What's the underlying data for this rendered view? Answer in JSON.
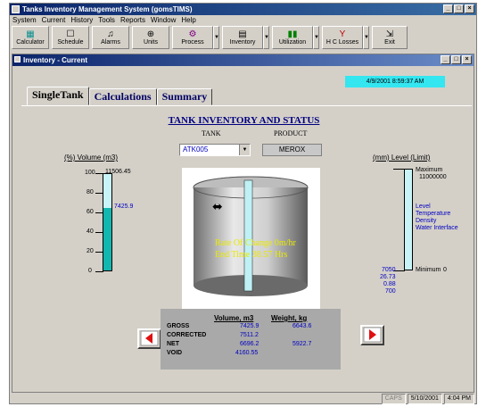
{
  "app": {
    "title": "Tanks Inventory Management System (gomsTIMS)",
    "menu": [
      "System",
      "Current",
      "History",
      "Tools",
      "Reports",
      "Window",
      "Help"
    ],
    "toolbar": [
      {
        "label": "Calculator",
        "icon": "calculator-icon"
      },
      {
        "label": "Schedule",
        "icon": "schedule-icon"
      },
      {
        "label": "Alarms",
        "icon": "bell-icon"
      },
      {
        "label": "Units",
        "icon": "units-icon"
      },
      {
        "label": "Process",
        "icon": "process-icon",
        "dropdown": true
      },
      {
        "label": "Inventory",
        "icon": "inventory-icon",
        "dropdown": true
      },
      {
        "label": "Utilization",
        "icon": "utilization-chart-icon",
        "dropdown": true
      },
      {
        "label": "H C Losses",
        "icon": "losses-icon",
        "dropdown": true
      },
      {
        "label": "Exit",
        "icon": "exit-icon"
      }
    ]
  },
  "child": {
    "title": "Inventory - Current",
    "datetime": "4/9/2001 8:59:37 AM",
    "tabs": [
      "SingleTank",
      "Calculations",
      "Summary"
    ],
    "active_tab": "SingleTank"
  },
  "main": {
    "heading": "TANK INVENTORY AND STATUS",
    "tank_label": "TANK",
    "product_label": "PRODUCT",
    "tank_value": "ATK005",
    "product_value": "MEROX"
  },
  "volume_gauge": {
    "title": "(%) Volume (m3)",
    "max_value": "11506.45",
    "current_value": "7425.9",
    "fill_percent": 64.5,
    "ticks": [
      "100",
      "80",
      "60",
      "40",
      "20",
      "0"
    ]
  },
  "level_gauge": {
    "title": "(mm) Level (Limit)",
    "maximum_label": "Maximum",
    "maximum_value": "11000000",
    "minimum_label": "Minimum",
    "minimum_value": "0",
    "legend": [
      "Level",
      "Temperature",
      "Density",
      "Water Interface"
    ],
    "readings": [
      "7050",
      "26.73",
      "0.88",
      "700"
    ]
  },
  "tank_overlay": {
    "rate_of_change": "Rate Of Change  0m/hr",
    "end_time": "End Time  38:57 Hrs"
  },
  "table": {
    "headers": [
      "Volume, m3",
      "Weight, kg"
    ],
    "rows": [
      {
        "label": "GROSS",
        "volume": "7425.9",
        "weight": "6643.6"
      },
      {
        "label": "CORRECTED",
        "volume": "7511.2",
        "weight": ""
      },
      {
        "label": "NET",
        "volume": "6696.2",
        "weight": "5922.7"
      },
      {
        "label": "VOID",
        "volume": "4160.55",
        "weight": ""
      }
    ]
  },
  "statusbar": {
    "caps": "CAPS",
    "date": "5/10/2001",
    "time": "4:04 PM"
  },
  "colors": {
    "title_gradient_start": "#0a246a",
    "gauge_fill": "#12b7b0",
    "date_box": "#33e6f0",
    "value_blue": "#0000c0",
    "arrow_red": "#e01010"
  }
}
